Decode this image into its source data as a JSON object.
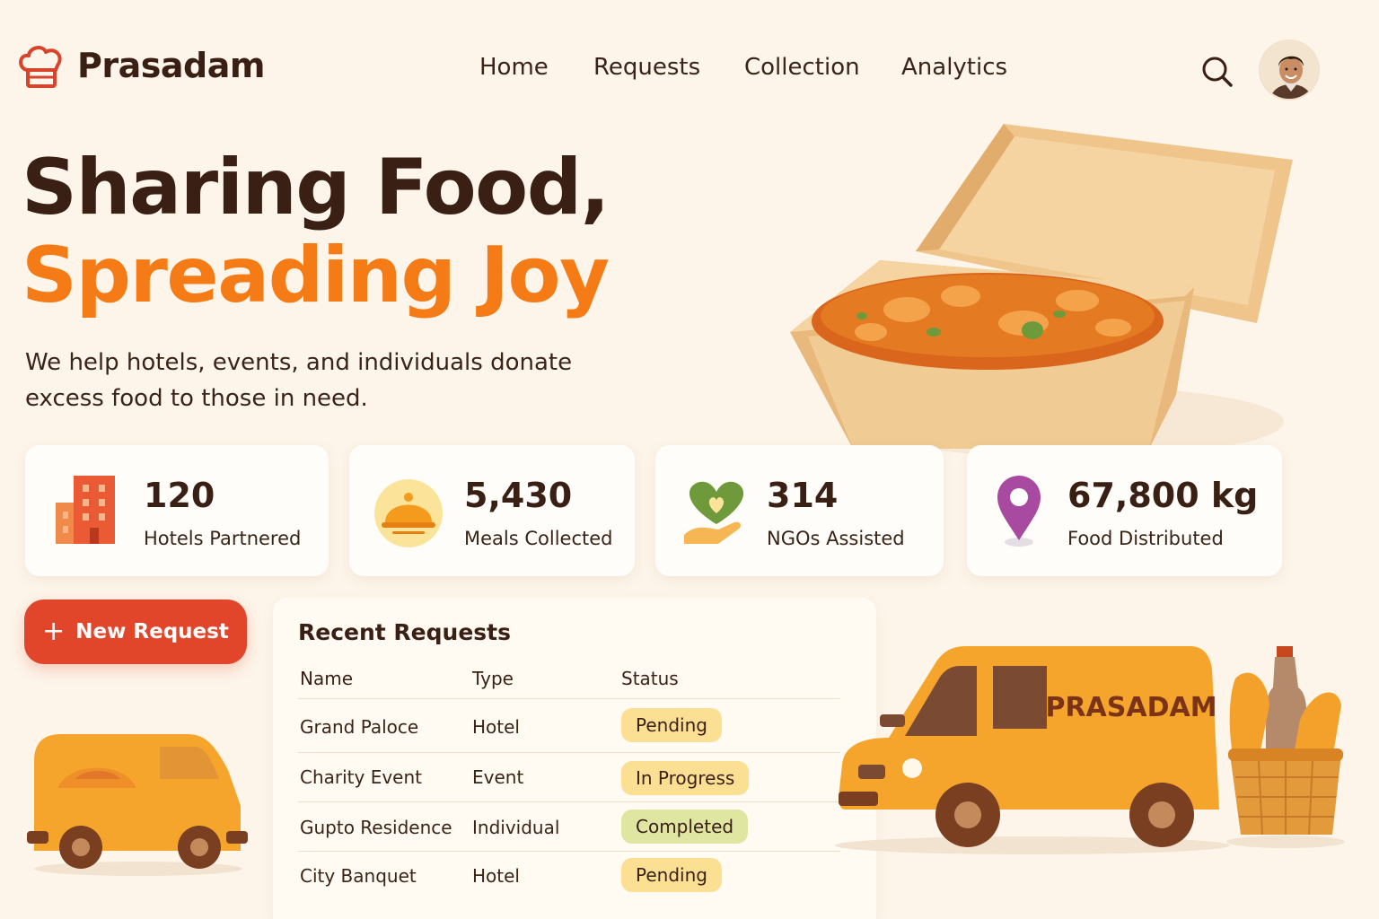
{
  "brand": {
    "name": "Prasadam",
    "icon": "chef-hat-icon"
  },
  "nav": {
    "items": [
      {
        "label": "Home"
      },
      {
        "label": "Requests"
      },
      {
        "label": "Collection"
      },
      {
        "label": "Analytics"
      }
    ]
  },
  "header": {
    "search_icon": "search-icon",
    "avatar": "user-avatar"
  },
  "hero": {
    "title_line1": "Sharing Food,",
    "title_line2": "Spreading Joy",
    "subtitle": "We help hotels, events, and individuals donate excess food to those in need."
  },
  "stats": [
    {
      "value": "120",
      "label": "Hotels Partnered",
      "icon": "building-icon"
    },
    {
      "value": "5,430",
      "label": "Meals Collected",
      "icon": "food-cloche-icon"
    },
    {
      "value": "314",
      "label": "NGOs Assisted",
      "icon": "heart-hand-icon"
    },
    {
      "value": "67,800 kg",
      "label": "Food Distributed",
      "icon": "location-pin-icon"
    }
  ],
  "actions": {
    "new_request": "New Request",
    "plus_glyph": "+"
  },
  "recent": {
    "title": "Recent Requests",
    "columns": [
      "Name",
      "Type",
      "Status"
    ],
    "rows": [
      {
        "name": "Grand Paloce",
        "type": "Hotel",
        "status": "Pending"
      },
      {
        "name": "Charity Event",
        "type": "Event",
        "status": "In Progress"
      },
      {
        "name": "Gupto Residence",
        "type": "Individual",
        "status": "Completed"
      },
      {
        "name": "City Banquet",
        "type": "Hotel",
        "status": "Pending"
      }
    ]
  },
  "illustrations": {
    "van_label": "PRASADAM"
  },
  "colors": {
    "background": "#fdf5ea",
    "accent_orange": "#f47b16",
    "button_red": "#e2462a",
    "text_dark": "#3a1f14",
    "badge_yellow": "#fbdf93",
    "badge_green": "#dfe6a2"
  }
}
